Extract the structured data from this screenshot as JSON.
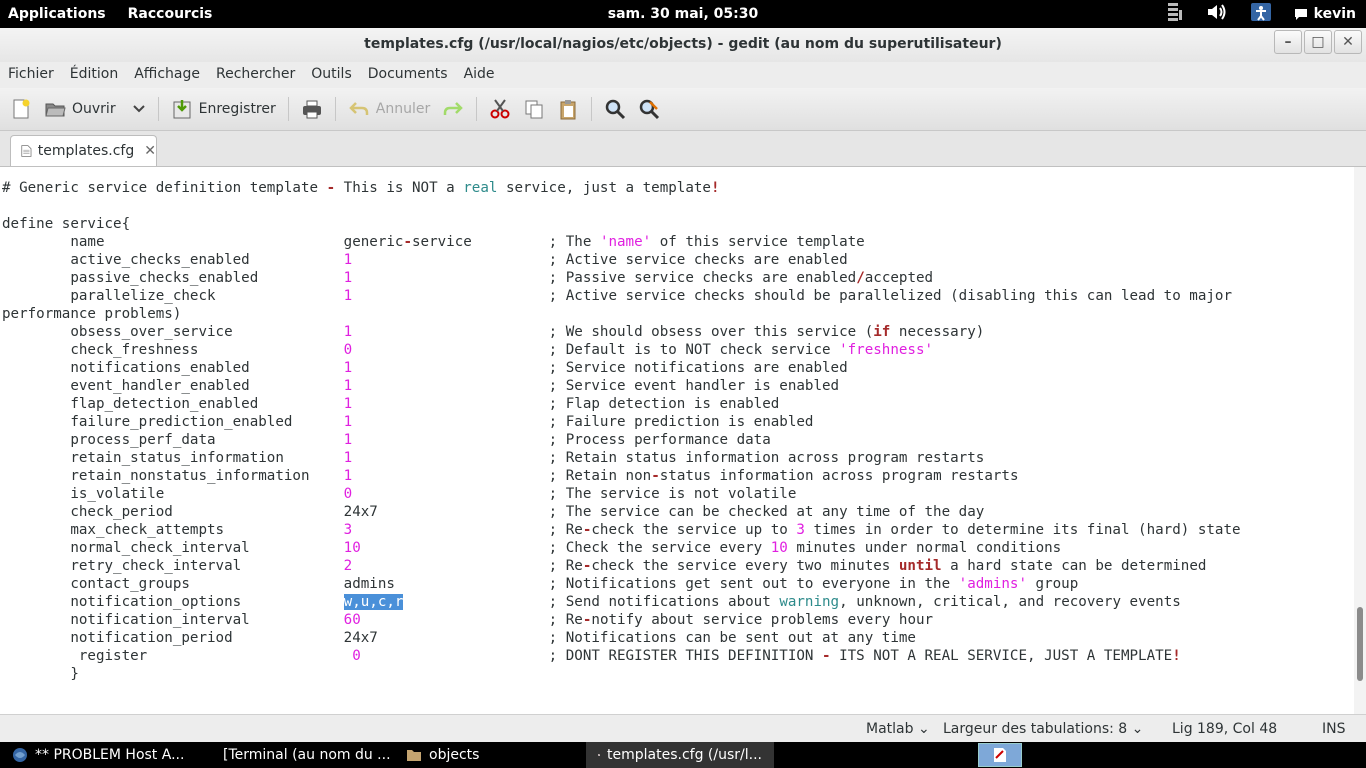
{
  "topbar": {
    "applications": "Applications",
    "shortcuts": "Raccourcis",
    "clock": "sam. 30 mai, 05:30",
    "user": "kevin"
  },
  "window": {
    "title": "templates.cfg (/usr/local/nagios/etc/objects) - gedit (au nom du superutilisateur)"
  },
  "menu": [
    "Fichier",
    "Édition",
    "Affichage",
    "Rechercher",
    "Outils",
    "Documents",
    "Aide"
  ],
  "toolbar": {
    "open_label": "Ouvrir",
    "save_label": "Enregistrer",
    "undo_label": "Annuler"
  },
  "tab": {
    "label": "templates.cfg"
  },
  "editor": {
    "lines": [
      "# Generic service definition template - This is NOT a real service, just a template!",
      "",
      "define service{",
      "        name                            generic-service         ; The 'name' of this service template",
      "        active_checks_enabled           1                       ; Active service checks are enabled",
      "        passive_checks_enabled          1                       ; Passive service checks are enabled/accepted",
      "        parallelize_check               1                       ; Active service checks should be parallelized (disabling this can lead to major",
      "performance problems)",
      "        obsess_over_service             1                       ; We should obsess over this service (if necessary)",
      "        check_freshness                 0                       ; Default is to NOT check service 'freshness'",
      "        notifications_enabled           1                       ; Service notifications are enabled",
      "        event_handler_enabled           1                       ; Service event handler is enabled",
      "        flap_detection_enabled          1                       ; Flap detection is enabled",
      "        failure_prediction_enabled      1                       ; Failure prediction is enabled",
      "        process_perf_data               1                       ; Process performance data",
      "        retain_status_information       1                       ; Retain status information across program restarts",
      "        retain_nonstatus_information    1                       ; Retain non-status information across program restarts",
      "        is_volatile                     0                       ; The service is not volatile",
      "        check_period                    24x7                    ; The service can be checked at any time of the day",
      "        max_check_attempts              3                       ; Re-check the service up to 3 times in order to determine its final (hard) state",
      "        normal_check_interval           10                      ; Check the service every 10 minutes under normal conditions",
      "        retry_check_interval            2                       ; Re-check the service every two minutes until a hard state can be determined",
      "        contact_groups                  admins                  ; Notifications get sent out to everyone in the 'admins' group",
      "        notification_options            w,u,c,r                 ; Send notifications about warning, unknown, critical, and recovery events",
      "        notification_interval           60                      ; Re-notify about service problems every hour",
      "        notification_period             24x7                    ; Notifications can be sent out at any time",
      "         register                        0                      ; DONT REGISTER THIS DEFINITION - ITS NOT A REAL SERVICE, JUST A TEMPLATE!",
      "        }"
    ],
    "selected_text": "w,u,c,r"
  },
  "status": {
    "language": "Matlab",
    "tab_width": "Largeur des tabulations: 8",
    "position": "Lig 189, Col 48",
    "mode": "INS"
  },
  "taskbar": {
    "tasks": [
      "** PROBLEM Host A...",
      "[Terminal (au nom du ...",
      "objects",
      "templates.cfg (/usr/l..."
    ]
  },
  "colors": {
    "selection": "#4a90d9",
    "number": "#e020e0",
    "keyword": "#a52a2a"
  }
}
